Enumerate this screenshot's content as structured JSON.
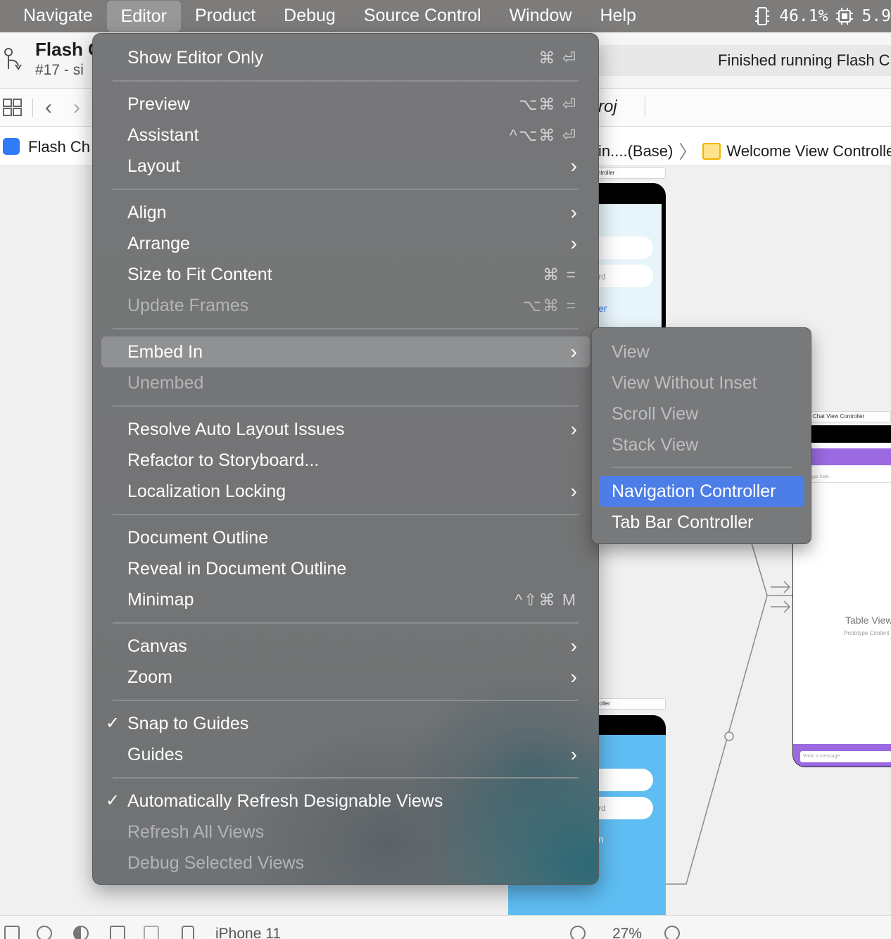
{
  "menubar": {
    "items": [
      "Navigate",
      "Editor",
      "Product",
      "Debug",
      "Source Control",
      "Window",
      "Help"
    ],
    "active_index": 1,
    "cpu_stat": "46.1%",
    "mem_stat": "5.9"
  },
  "toolbar": {
    "project_name": "Flash C",
    "project_sub": "#17 - si",
    "activity": "Finished running Flash C"
  },
  "tabbar": {
    "tab_text": "roj"
  },
  "jumpbar": {
    "left_text": "Flash Ch",
    "crumb": "in....(Base)",
    "scene": "Welcome View Controller"
  },
  "editor_menu": {
    "sections": [
      [
        {
          "label": "Show Editor Only",
          "shortcut": "⌘ ⏎"
        }
      ],
      [
        {
          "label": "Preview",
          "shortcut": "⌥⌘ ⏎"
        },
        {
          "label": "Assistant",
          "shortcut": "^⌥⌘ ⏎"
        },
        {
          "label": "Layout",
          "submenu": true
        }
      ],
      [
        {
          "label": "Align",
          "submenu": true
        },
        {
          "label": "Arrange",
          "submenu": true
        },
        {
          "label": "Size to Fit Content",
          "shortcut": "⌘ ="
        },
        {
          "label": "Update Frames",
          "shortcut": "⌥⌘ =",
          "disabled": true
        }
      ],
      [
        {
          "label": "Embed In",
          "submenu": true,
          "highlighted": true
        },
        {
          "label": "Unembed",
          "disabled": true
        }
      ],
      [
        {
          "label": "Resolve Auto Layout Issues",
          "submenu": true
        },
        {
          "label": "Refactor to Storyboard..."
        },
        {
          "label": "Localization Locking",
          "submenu": true
        }
      ],
      [
        {
          "label": "Document Outline"
        },
        {
          "label": "Reveal in Document Outline"
        },
        {
          "label": "Minimap",
          "shortcut": "^⇧⌘ M"
        }
      ],
      [
        {
          "label": "Canvas",
          "submenu": true
        },
        {
          "label": "Zoom",
          "submenu": true
        }
      ],
      [
        {
          "label": "Snap to Guides",
          "checked": true
        },
        {
          "label": "Guides",
          "submenu": true
        }
      ],
      [
        {
          "label": "Automatically Refresh Designable Views",
          "checked": true
        },
        {
          "label": "Refresh All Views",
          "disabled": true
        },
        {
          "label": "Debug Selected Views",
          "disabled": true
        }
      ]
    ]
  },
  "embed_submenu": {
    "items": [
      {
        "label": "View",
        "disabled": true
      },
      {
        "label": "View Without Inset",
        "disabled": true
      },
      {
        "label": "Scroll View",
        "disabled": true
      },
      {
        "label": "Stack View",
        "disabled": true
      },
      {
        "separator": true
      },
      {
        "label": "Navigation Controller",
        "selected": true
      },
      {
        "label": "Tab Bar Controller"
      }
    ]
  },
  "canvas": {
    "scene_label_top": "ntroller",
    "scene_label_right": "Chat View Controller",
    "scene_label_bottom": "roller",
    "field_hint_1": "rd",
    "link_text": "er",
    "field_hint_2": "rd",
    "link_text_2": "n",
    "table_title": "Table View",
    "table_sub": "Prototype Content",
    "proto_cells": "ype Cells",
    "message_placeholder": "Write a message"
  },
  "bottombar": {
    "device": "iPhone 11",
    "zoom": "27%"
  },
  "colors": {
    "menu_bg": "#737475",
    "highlight": "#8f9193",
    "selected": "#4d7ee8",
    "menubar_bg": "#7d7c7b"
  }
}
